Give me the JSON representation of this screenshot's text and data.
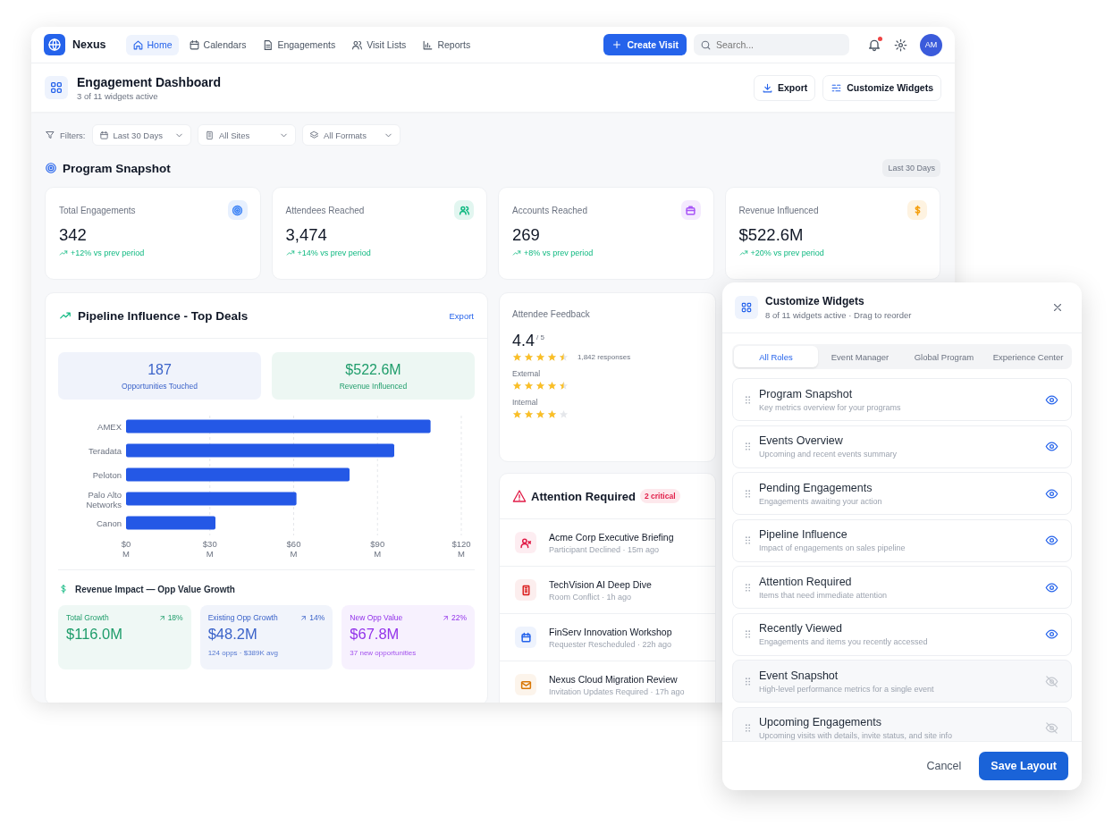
{
  "nav": {
    "brand": "Nexus",
    "items": [
      {
        "label": "Home",
        "selected": true
      },
      {
        "label": "Calendars",
        "selected": false
      },
      {
        "label": "Engagements",
        "selected": false
      },
      {
        "label": "Visit Lists",
        "selected": false
      },
      {
        "label": "Reports",
        "selected": false
      }
    ],
    "create_button": "Create Visit",
    "search": {
      "placeholder": "Search..."
    },
    "notifications": {
      "unread": true
    },
    "avatar": "AM"
  },
  "header": {
    "title": "Engagement Dashboard",
    "subtitle": "3 of 11 widgets active",
    "buttons": [
      "Export",
      "Customize Widgets"
    ]
  },
  "filters": {
    "label": "Filters:",
    "dropdowns": [
      "Last 30 Days",
      "All Sites",
      "All Formats"
    ]
  },
  "snapshot": {
    "title": "Program Snapshot",
    "period": "Last 30 Days",
    "metrics": [
      {
        "label": "Total Engagements",
        "value": "342",
        "change": "+12% vs prev period",
        "color": "#3b82f6"
      },
      {
        "label": "Attendees Reached",
        "value": "3,474",
        "change": "+14% vs prev period",
        "color": "#10b981"
      },
      {
        "label": "Accounts Reached",
        "value": "269",
        "change": "+8% vs prev period",
        "color": "#a855f7"
      },
      {
        "label": "Revenue Influenced",
        "value": "$522.6M",
        "change": "+20% vs prev period",
        "color": "#f59e0b"
      }
    ]
  },
  "pipeline": {
    "title": "Pipeline Influence - Top Deals",
    "export": "Export",
    "stats": [
      {
        "value": "187",
        "label": "Opportunities Touched",
        "color": "#3b63c9"
      },
      {
        "value": "$522.6M",
        "label": "Revenue Influenced",
        "color": "#1f9d6b"
      }
    ],
    "chart_data": {
      "type": "bar",
      "orientation": "horizontal",
      "categories": [
        "AMEX",
        "Teradata",
        "Peloton",
        "Palo Alto Networks",
        "Canon"
      ],
      "series": [
        {
          "color": "#2458e6",
          "values": [
            109,
            96,
            80,
            61,
            32
          ]
        }
      ],
      "xlim": [
        0,
        120
      ],
      "grid": true,
      "xticks": [
        {
          "value": 0,
          "label": "$0 M"
        },
        {
          "value": 30,
          "label": "$30 M"
        },
        {
          "value": 60,
          "label": "$60 M"
        },
        {
          "value": 90,
          "label": "$90 M"
        },
        {
          "value": 120,
          "label": "$120 M"
        }
      ]
    },
    "impact": {
      "title": "Revenue Impact — Opp Value Growth",
      "cards": [
        {
          "label": "Total Growth",
          "pct": "18%",
          "value": "$116.0M",
          "color": "#1f9d6b"
        },
        {
          "label": "Existing Opp Growth",
          "pct": "14%",
          "value": "$48.2M",
          "note": "124 opps · $389K avg",
          "color": "#3b63c9"
        },
        {
          "label": "New Opp Value",
          "pct": "22%",
          "value": "$67.8M",
          "note": "37 new opportunities",
          "color": "#9333ea"
        }
      ]
    }
  },
  "feedback": {
    "title": "Attendee Feedback",
    "score": "4.4",
    "scale": "/ 5",
    "stars": 4.5,
    "responses": "1,842 responses",
    "groups": [
      {
        "label": "External",
        "stars": 4.5
      },
      {
        "label": "Internal",
        "stars": 4
      }
    ]
  },
  "attention": {
    "title": "Attention Required",
    "badge": "2 critical",
    "items": [
      {
        "title": "Acme Corp Executive Briefing",
        "detail": "Participant Declined · 15m ago",
        "color": "#e11d48"
      },
      {
        "title": "TechVision AI Deep Dive",
        "detail": "Room Conflict · 1h ago",
        "color": "#dc2626"
      },
      {
        "title": "FinServ Innovation Workshop",
        "detail": "Requester Rescheduled · 22h ago",
        "color": "#2563eb"
      },
      {
        "title": "Nexus Cloud Migration Review",
        "detail": "Invitation Updates Required · 17h ago",
        "color": "#d97706"
      }
    ]
  },
  "customize": {
    "title": "Customize Widgets",
    "subtitle": "8 of 11 widgets active · Drag to reorder",
    "tabs": [
      {
        "label": "All Roles",
        "selected": true
      },
      {
        "label": "Event Manager",
        "selected": false
      },
      {
        "label": "Global Program",
        "selected": false
      },
      {
        "label": "Experience Center",
        "selected": false
      }
    ],
    "widgets": [
      {
        "name": "Program Snapshot",
        "description": "Key metrics overview for your programs",
        "visible": true
      },
      {
        "name": "Events Overview",
        "description": "Upcoming and recent events summary",
        "visible": true
      },
      {
        "name": "Pending Engagements",
        "description": "Engagements awaiting your action",
        "visible": true
      },
      {
        "name": "Pipeline Influence",
        "description": "Impact of engagements on sales pipeline",
        "visible": true
      },
      {
        "name": "Attention Required",
        "description": "Items that need immediate attention",
        "visible": true
      },
      {
        "name": "Recently Viewed",
        "description": "Engagements and items you recently accessed",
        "visible": true
      },
      {
        "name": "Event Snapshot",
        "description": "High-level performance metrics for a single event",
        "visible": false
      },
      {
        "name": "Upcoming Engagements",
        "description": "Upcoming visits with details, invite status, and site info",
        "visible": false
      }
    ],
    "cancel": "Cancel",
    "save": "Save Layout"
  }
}
